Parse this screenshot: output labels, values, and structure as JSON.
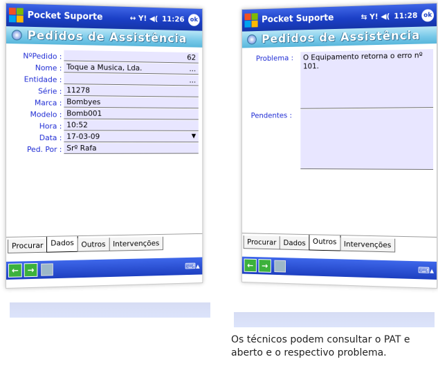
{
  "app": {
    "title": "Pocket Suporte",
    "time_left": "11:26",
    "time_right": "11:28",
    "ok_label": "ok",
    "banner": "Pedidos de Assistência",
    "sys_left": "↔ Y! ◀(",
    "sys_right": "⇆ Y! ◀("
  },
  "form": {
    "fields": [
      {
        "label": "NºPedido :",
        "value": "62",
        "numeric": true
      },
      {
        "label": "Nome :",
        "value": "Toque a Musica, Lda.",
        "ellipsis": "..."
      },
      {
        "label": "Entidade :",
        "value": "",
        "ellipsis": "..."
      },
      {
        "label": "Série :",
        "value": "11278"
      },
      {
        "label": "Marca :",
        "value": "Bombyes"
      },
      {
        "label": "Modelo :",
        "value": "Bomb001"
      },
      {
        "label": "Hora :",
        "value": "10:52"
      },
      {
        "label": "Data :",
        "value": "17-03-09",
        "dropdown": "▼"
      },
      {
        "label": "Ped. Por :",
        "value": "Srº Rafa"
      }
    ]
  },
  "outros": {
    "problema_label": "Problema :",
    "problema_value": "O Equipamento retorna o erro nº 101.",
    "pendentes_label": "Pendentes :",
    "pendentes_value": ""
  },
  "tabs": [
    "Procurar",
    "Dados",
    "Outros",
    "Intervenções"
  ],
  "caption": {
    "line1": "Os técnicos podem consultar o PAT e",
    "line2": "aberto e o respectivo problema."
  }
}
